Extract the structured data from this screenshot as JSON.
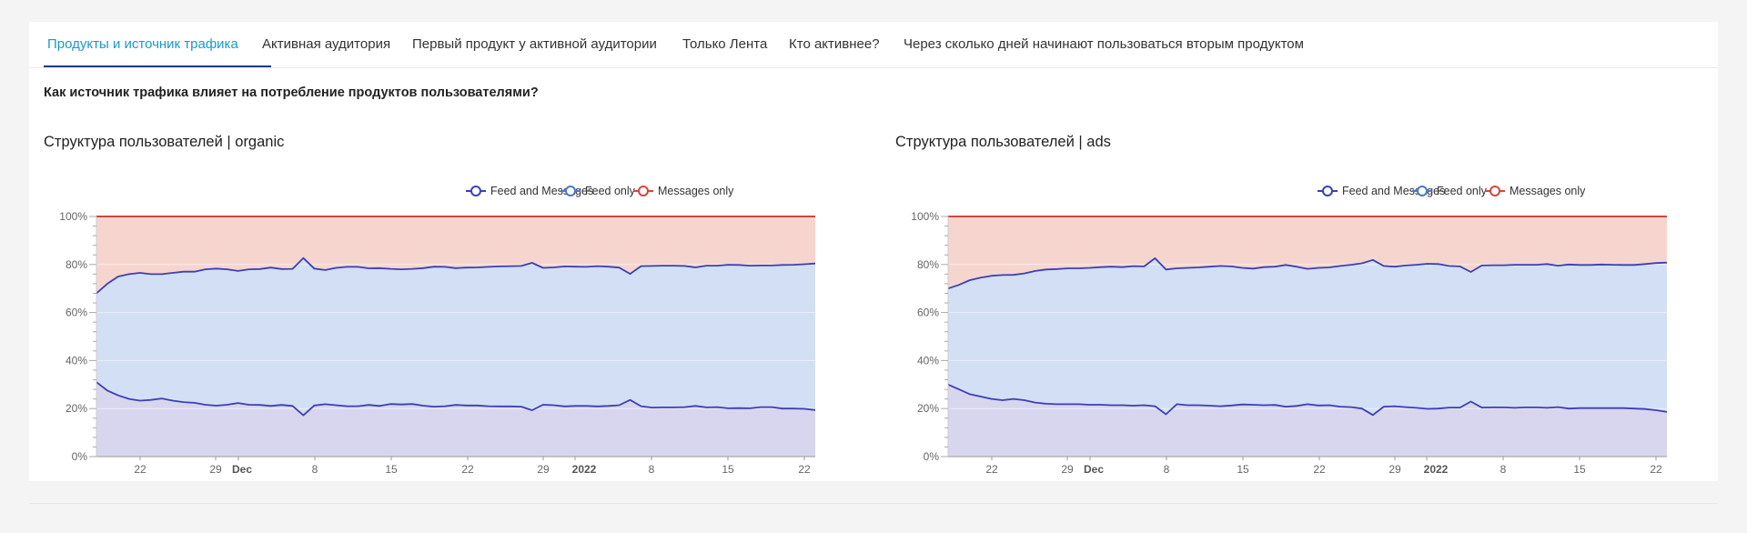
{
  "tabs": [
    {
      "label": "Продукты и источник трафика",
      "active": true
    },
    {
      "label": "Активная аудитория",
      "active": false
    },
    {
      "label": "Первый продукт у активной аудитории",
      "active": false
    },
    {
      "label": "Только Лента",
      "active": false
    },
    {
      "label": "Кто активнее?",
      "active": false
    },
    {
      "label": "Через сколько дней начинают пользоваться вторым продуктом",
      "active": false
    }
  ],
  "question": "Как источник трафика влияет на потребление продуктов пользователями?",
  "colors": {
    "feed_and_messages": "#3b3fb5",
    "feed_only": "#4a78c8",
    "messages_only": "#d0473a",
    "fill_feed_and_messages": "#d8d6ef",
    "fill_feed_only": "#d3dff4",
    "fill_messages_only": "#f7d5cf",
    "active_tab": "#1a9bc7"
  },
  "chart_data": [
    {
      "type": "area",
      "stacked": "percent",
      "title": "Структура пользователей | organic",
      "legend": [
        "Feed and Messages",
        "Feed only",
        "Messages only"
      ],
      "legend_position": "top-right",
      "ylim": [
        0,
        100
      ],
      "y_ticks": [
        "0%",
        "20%",
        "40%",
        "60%",
        "80%",
        "100%"
      ],
      "x_ticks": [
        {
          "label": "22",
          "bold": false
        },
        {
          "label": "29",
          "bold": false
        },
        {
          "label": "Dec",
          "bold": true
        },
        {
          "label": "8",
          "bold": false
        },
        {
          "label": "15",
          "bold": false
        },
        {
          "label": "22",
          "bold": false
        },
        {
          "label": "29",
          "bold": false
        },
        {
          "label": "2022",
          "bold": true
        },
        {
          "label": "8",
          "bold": false
        },
        {
          "label": "15",
          "bold": false
        },
        {
          "label": "22",
          "bold": false
        }
      ],
      "series": [
        {
          "name": "Feed and Messages",
          "values": [
            31,
            27.5,
            25.5,
            24,
            23.3,
            23.6,
            24.2,
            23.3,
            22.7,
            22.4,
            21.6,
            21.2,
            21.6,
            22.3,
            21.6,
            21.5,
            21.1,
            21.5,
            21.1,
            17.2,
            21.3,
            21.8,
            21.4,
            21,
            21,
            21.5,
            21.1,
            21.9,
            21.7,
            21.9,
            21.2,
            20.8,
            21,
            21.5,
            21.3,
            21.3,
            21,
            20.9,
            20.9,
            20.8,
            19.3,
            21.6,
            21.4,
            20.9,
            21.1,
            21.1,
            20.9,
            21.1,
            21.4,
            23.6,
            21,
            20.4,
            20.5,
            20.5,
            20.6,
            21.1,
            20.5,
            20.6,
            20.1,
            20.2,
            20.1,
            20.6,
            20.6,
            20,
            20,
            19.9,
            19.4
          ]
        },
        {
          "name": "Feed only",
          "values": [
            37,
            44.5,
            49.5,
            52,
            53.2,
            52.4,
            51.8,
            53.2,
            54.3,
            54.6,
            56.4,
            57.1,
            56.4,
            55,
            56.4,
            56.6,
            57.6,
            56.6,
            57.1,
            65.5,
            57,
            55.9,
            57.2,
            58,
            58,
            56.9,
            57.4,
            56.3,
            56.3,
            56.3,
            57.3,
            58.3,
            58,
            57,
            57.4,
            57.5,
            58,
            58.3,
            58.4,
            58.6,
            61.4,
            57,
            57.4,
            58.3,
            58,
            57.9,
            58.4,
            58,
            57.3,
            52.5,
            58.3,
            59,
            59,
            59,
            58.8,
            57.7,
            59,
            58.9,
            59.8,
            59.6,
            59.4,
            59,
            59,
            59.8,
            59.9,
            60.2,
            61
          ]
        },
        {
          "name": "Messages only",
          "values": [
            32,
            28,
            25,
            24,
            23.5,
            24,
            24,
            23.5,
            23,
            23,
            22,
            21.7,
            22,
            22.7,
            22,
            21.9,
            21.3,
            21.9,
            21.8,
            17.3,
            21.7,
            22.3,
            21.4,
            21,
            21,
            21.6,
            21.5,
            21.8,
            22,
            21.8,
            21.5,
            20.9,
            21,
            21.5,
            21.3,
            21.2,
            21,
            20.8,
            20.7,
            20.6,
            19.3,
            21.4,
            21.2,
            20.8,
            20.9,
            21,
            20.7,
            20.9,
            21.3,
            23.9,
            20.7,
            20.6,
            20.5,
            20.5,
            20.6,
            21.2,
            20.5,
            20.5,
            20.1,
            20.2,
            20.5,
            20.4,
            20.4,
            20.2,
            20.1,
            19.9,
            19.6
          ]
        }
      ]
    },
    {
      "type": "area",
      "stacked": "percent",
      "title": "Структура пользователей | ads",
      "legend": [
        "Feed and Messages",
        "Feed only",
        "Messages only"
      ],
      "legend_position": "top-right",
      "ylim": [
        0,
        100
      ],
      "y_ticks": [
        "0%",
        "20%",
        "40%",
        "60%",
        "80%",
        "100%"
      ],
      "x_ticks": [
        {
          "label": "22",
          "bold": false
        },
        {
          "label": "29",
          "bold": false
        },
        {
          "label": "Dec",
          "bold": true
        },
        {
          "label": "8",
          "bold": false
        },
        {
          "label": "15",
          "bold": false
        },
        {
          "label": "22",
          "bold": false
        },
        {
          "label": "29",
          "bold": false
        },
        {
          "label": "2022",
          "bold": true
        },
        {
          "label": "8",
          "bold": false
        },
        {
          "label": "15",
          "bold": false
        },
        {
          "label": "22",
          "bold": false
        }
      ],
      "series": [
        {
          "name": "Feed and Messages",
          "values": [
            30,
            28,
            26,
            25,
            24,
            23.5,
            24,
            23.5,
            22.5,
            22,
            21.8,
            21.8,
            21.8,
            21.6,
            21.6,
            21.4,
            21.4,
            21.2,
            21.4,
            21,
            17.6,
            21.8,
            21.4,
            21.4,
            21.2,
            21,
            21.3,
            21.7,
            21.6,
            21.4,
            21.5,
            20.8,
            21.1,
            21.8,
            21.3,
            21.4,
            20.8,
            20.6,
            20,
            17.3,
            20.8,
            21,
            20.6,
            20.3,
            19.9,
            20,
            20.4,
            20.4,
            22.9,
            20.4,
            20.5,
            20.5,
            20.3,
            20.5,
            20.5,
            20.3,
            20.6,
            20,
            20.2,
            20.2,
            20.2,
            20.2,
            20.2,
            20,
            19.8,
            19.3,
            18.6
          ]
        },
        {
          "name": "Feed only",
          "values": [
            40,
            43.5,
            47.5,
            49.5,
            51.3,
            52.1,
            51.7,
            52.8,
            54.8,
            55.9,
            56.3,
            56.6,
            56.6,
            57,
            57.3,
            57.7,
            57.5,
            58.1,
            57.8,
            61.6,
            60.3,
            56.6,
            57.2,
            57.4,
            57.9,
            58.4,
            57.9,
            56.9,
            56.7,
            57.5,
            57.6,
            59,
            58,
            56.4,
            57.3,
            57.4,
            58.6,
            59.3,
            60.5,
            64.6,
            58.6,
            58.1,
            59,
            59.6,
            60.4,
            60.2,
            59,
            58.8,
            54,
            59.2,
            59.2,
            59.2,
            59.6,
            59.4,
            59.4,
            59.9,
            58.9,
            60,
            59.6,
            59.6,
            59.8,
            59.7,
            59.6,
            59.8,
            60.4,
            61.3,
            62.2
          ]
        },
        {
          "name": "Messages only",
          "values": [
            30,
            28.5,
            26.5,
            25.5,
            24.7,
            24.4,
            24.3,
            23.7,
            22.7,
            22.1,
            21.9,
            21.6,
            21.6,
            21.4,
            21.1,
            20.9,
            21.1,
            20.7,
            20.8,
            17.4,
            22.1,
            21.6,
            21.4,
            21.2,
            20.9,
            20.6,
            20.8,
            21.4,
            21.7,
            21.1,
            20.9,
            20.2,
            20.9,
            21.8,
            21.4,
            21.2,
            20.6,
            20.1,
            19.5,
            18.1,
            20.6,
            20.9,
            20.4,
            20.1,
            19.7,
            19.8,
            20.6,
            20.8,
            23.1,
            20.4,
            20.3,
            20.3,
            20.1,
            20.1,
            20.1,
            19.8,
            20.5,
            20,
            20.2,
            20.2,
            20,
            20.1,
            20.2,
            20.2,
            19.8,
            19.4,
            19.2
          ]
        }
      ]
    }
  ]
}
